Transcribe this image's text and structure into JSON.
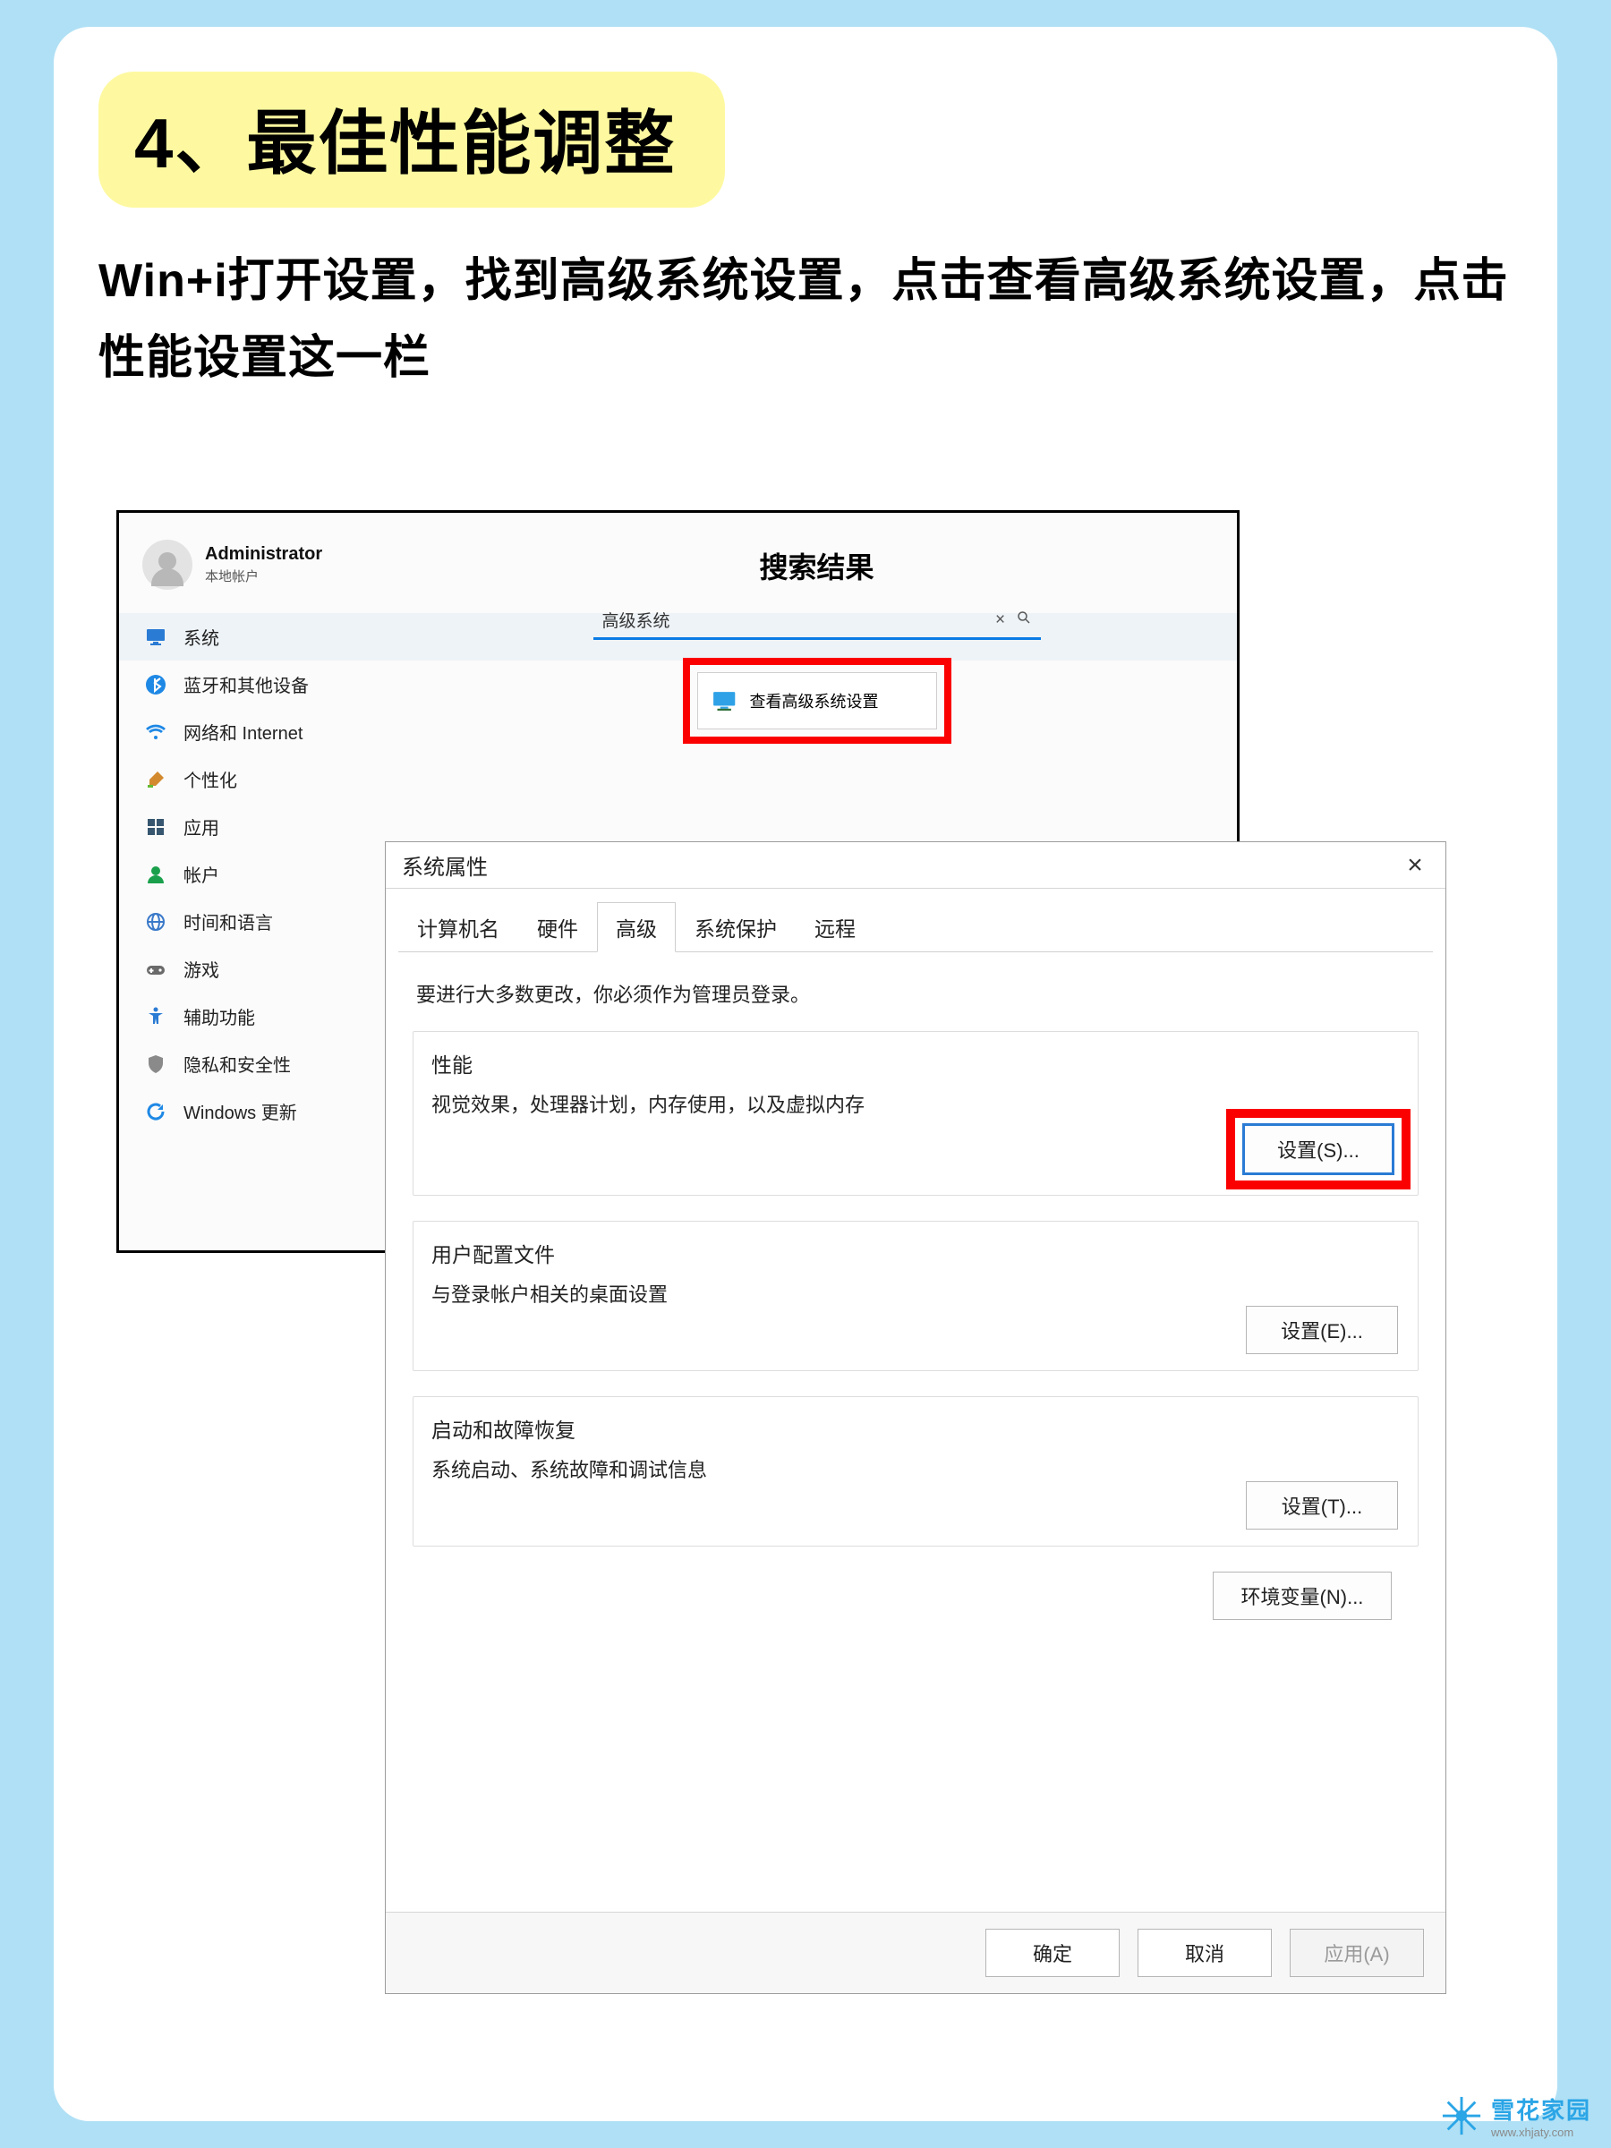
{
  "header": {
    "title": "4、最佳性能调整",
    "instructions": "Win+i打开设置，找到高级系统设置，点击查看高级系统设置，点击性能设置这一栏"
  },
  "settings": {
    "account": {
      "name": "Administrator",
      "sub": "本地帐户"
    },
    "nav": [
      {
        "id": "system",
        "label": "系统",
        "icon": "monitor-icon",
        "color": "#2a7bd4",
        "selected": true
      },
      {
        "id": "bt",
        "label": "蓝牙和其他设备",
        "icon": "bluetooth-icon",
        "color": "#1e88e5"
      },
      {
        "id": "net",
        "label": "网络和 Internet",
        "icon": "wifi-icon",
        "color": "#1e88e5"
      },
      {
        "id": "pers",
        "label": "个性化",
        "icon": "brush-icon",
        "color": "#d38a2f"
      },
      {
        "id": "apps",
        "label": "应用",
        "icon": "apps-icon",
        "color": "#37566f"
      },
      {
        "id": "acct",
        "label": "帐户",
        "icon": "person-icon",
        "color": "#1aa04c"
      },
      {
        "id": "time",
        "label": "时间和语言",
        "icon": "globe-icon",
        "color": "#3a79c9"
      },
      {
        "id": "game",
        "label": "游戏",
        "icon": "gamepad-icon",
        "color": "#6a6a6a"
      },
      {
        "id": "access",
        "label": "辅助功能",
        "icon": "accessibility-icon",
        "color": "#2a7bd4"
      },
      {
        "id": "privacy",
        "label": "隐私和安全性",
        "icon": "shield-icon",
        "color": "#8a8a8a"
      },
      {
        "id": "update",
        "label": "Windows 更新",
        "icon": "refresh-icon",
        "color": "#1e88e5"
      }
    ],
    "results": {
      "title": "搜索结果",
      "query": "高级系统",
      "item": "查看高级系统设置"
    }
  },
  "dialog": {
    "title": "系统属性",
    "tabs": [
      "计算机名",
      "硬件",
      "高级",
      "系统保护",
      "远程"
    ],
    "active_tab": 2,
    "note": "要进行大多数更改，你必须作为管理员登录。",
    "groups": {
      "perf": {
        "title": "性能",
        "desc": "视觉效果，处理器计划，内存使用，以及虚拟内存",
        "btn": "设置(S)..."
      },
      "profile": {
        "title": "用户配置文件",
        "desc": "与登录帐户相关的桌面设置",
        "btn": "设置(E)..."
      },
      "startup": {
        "title": "启动和故障恢复",
        "desc": "系统启动、系统故障和调试信息",
        "btn": "设置(T)..."
      }
    },
    "env_btn": "环境变量(N)...",
    "footer": {
      "ok": "确定",
      "cancel": "取消",
      "apply": "应用(A)"
    }
  },
  "watermark": {
    "brand": "雪花家园",
    "url": "www.xhjaty.com"
  }
}
